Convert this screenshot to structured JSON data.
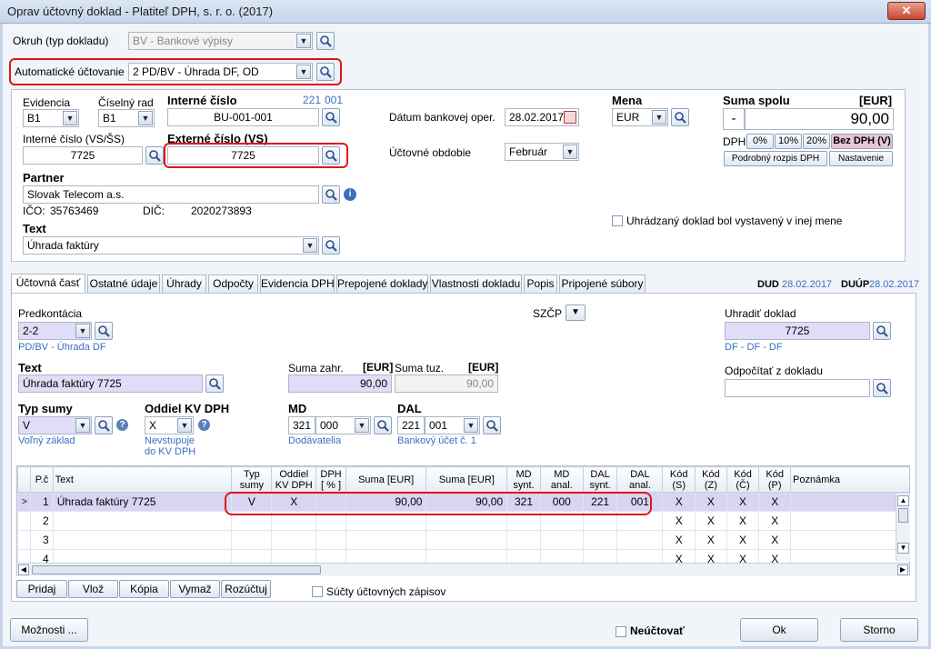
{
  "window": {
    "title": "Oprav účtovný doklad - Platiteľ DPH, s. r. o. (2017)",
    "close": "✕"
  },
  "okruh": {
    "label": "Okruh (typ dokladu)",
    "value": "BV - Bankové výpisy"
  },
  "automaticke": {
    "label": "Automatické účtovanie",
    "value": "2 PD/BV - Úhrada DF, OD"
  },
  "evidencia": {
    "label": "Evidencia",
    "value": "B1"
  },
  "ciselny_rad": {
    "label": "Číselný rad",
    "value": "B1"
  },
  "interne_cislo": {
    "label": "Interné číslo",
    "counter_a": "221",
    "counter_b": "001",
    "value": "BU-001-001"
  },
  "interne_vs": {
    "label": "Interné číslo (VS/ŠS)",
    "value": "7725"
  },
  "externe_vs": {
    "label": "Externé číslo (VS)",
    "value": "7725"
  },
  "datum": {
    "label": "Dátum bankovej oper.",
    "value": "28.02.2017"
  },
  "obdobie": {
    "label": "Účtovné obdobie",
    "value": "Február"
  },
  "mena": {
    "label": "Mena",
    "value": "EUR"
  },
  "suma_spolu": {
    "label": "Suma spolu",
    "unit": "[EUR]",
    "sign": "-",
    "value": "90,00"
  },
  "dph": {
    "label": "DPH",
    "b0": "0%",
    "b10": "10%",
    "b20": "20%",
    "bez": "Bez DPH (V)",
    "rozpis": "Podrobný rozpis DPH",
    "nastavenie": "Nastavenie"
  },
  "partner": {
    "label": "Partner",
    "value": "Slovak Telecom a.s.",
    "ico_label": "IČO:",
    "ico": "35763469",
    "dic_label": "DIČ:",
    "dic": "2020273893"
  },
  "uhradzany": {
    "label": "Uhrádzaný doklad bol vystavený v inej mene"
  },
  "text": {
    "label": "Text",
    "value": "Úhrada faktúry"
  },
  "tabs": [
    "Účtovná časť",
    "Ostatné údaje",
    "Úhrady",
    "Odpočty",
    "Evidencia DPH",
    "Prepojené doklady",
    "Vlastnosti dokladu",
    "Popis",
    "Pripojené súbory"
  ],
  "dud": {
    "label": "DUD",
    "value": "28.02.2017"
  },
  "duup": {
    "label": "DUÚP",
    "value": "28.02.2017"
  },
  "predkontacia": {
    "label": "Predkontácia",
    "value": "2-2",
    "hint": "PD/BV - Úhrada DF"
  },
  "szcp": {
    "label": "SZČP"
  },
  "uhradit": {
    "label": "Uhradiť doklad",
    "value": "7725",
    "hint": "DF - DF - DF"
  },
  "odpocitat": {
    "label": "Odpočítať z dokladu",
    "value": ""
  },
  "text2": {
    "label": "Text",
    "value": "Úhrada faktúry 7725"
  },
  "suma_zahr": {
    "label": "Suma zahr.",
    "unit": "[EUR]",
    "value": "90,00"
  },
  "suma_tuz": {
    "label": "Suma tuz.",
    "unit": "[EUR]",
    "value": "90,00"
  },
  "typ_sumy": {
    "label": "Typ sumy",
    "value": "V",
    "hint": "Voľný základ"
  },
  "oddiel": {
    "label": "Oddiel KV DPH",
    "value": "X",
    "hint1": "Nevstupuje",
    "hint2": "do KV DPH"
  },
  "md": {
    "label": "MD",
    "synt": "321",
    "anal": "000",
    "hint": "Dodávatelia"
  },
  "dal": {
    "label": "DAL",
    "synt": "221",
    "anal": "001",
    "hint": "Bankový účet č. 1"
  },
  "grid": {
    "headers": [
      "P.č",
      "Text",
      "Typ sumy",
      "Oddiel KV DPH",
      "DPH [ % ]",
      "Suma [EUR]",
      "Suma [EUR]",
      "MD synt.",
      "MD anal.",
      "DAL synt.",
      "DAL anal.",
      "Kód (S)",
      "Kód (Z)",
      "Kód (Č)",
      "Kód (P)",
      "Poznámka"
    ],
    "rows": [
      {
        "n": "1",
        "text": "Úhrada faktúry 7725",
        "typ": "V",
        "oddiel": "X",
        "dph": "",
        "suma1": "90,00",
        "suma2": "90,00",
        "mds": "321",
        "mda": "000",
        "dals": "221",
        "dala": "001",
        "s": "X",
        "z": "X",
        "c": "X",
        "p": "X",
        "pozn": ""
      },
      {
        "n": "2",
        "text": "",
        "typ": "",
        "oddiel": "",
        "dph": "",
        "suma1": "",
        "suma2": "",
        "mds": "",
        "mda": "",
        "dals": "",
        "dala": "",
        "s": "X",
        "z": "X",
        "c": "X",
        "p": "X",
        "pozn": ""
      },
      {
        "n": "3",
        "text": "",
        "typ": "",
        "oddiel": "",
        "dph": "",
        "suma1": "",
        "suma2": "",
        "mds": "",
        "mda": "",
        "dals": "",
        "dala": "",
        "s": "X",
        "z": "X",
        "c": "X",
        "p": "X",
        "pozn": ""
      },
      {
        "n": "4",
        "text": "",
        "typ": "",
        "oddiel": "",
        "dph": "",
        "suma1": "",
        "suma2": "",
        "mds": "",
        "mda": "",
        "dals": "",
        "dala": "",
        "s": "X",
        "z": "X",
        "c": "X",
        "p": "X",
        "pozn": ""
      }
    ]
  },
  "grid_buttons": {
    "pridaj": "Pridaj",
    "vloz": "Vlož",
    "kopia": "Kópia",
    "vymaz": "Vymaž",
    "rozuctuj": "Rozúčtuj"
  },
  "sucty": {
    "label": "Súčty účtovných zápisov"
  },
  "moznosti": "Možnosti ...",
  "neuctovat": "Neúčtovať",
  "ok": "Ok",
  "storno": "Storno"
}
